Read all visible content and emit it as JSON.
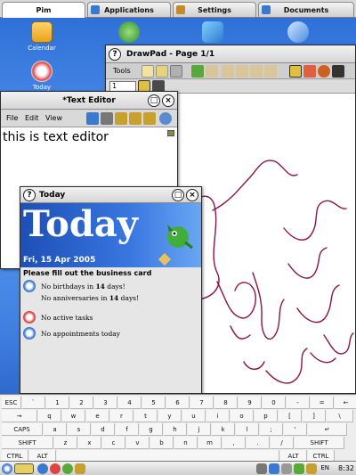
{
  "tabs": [
    {
      "label": "Pim",
      "active": true
    },
    {
      "label": "Applications",
      "active": false
    },
    {
      "label": "Settings",
      "active": false
    },
    {
      "label": "Documents",
      "active": false
    }
  ],
  "desktop_icons": [
    {
      "label": "Calendar",
      "icon": "calendar-icon"
    },
    {
      "label": "Today",
      "icon": "today-icon"
    }
  ],
  "drawpad": {
    "title": "DrawPad - Page 1/1",
    "tools_label": "Tools",
    "page_value": "1"
  },
  "text_editor": {
    "title": "*Text Editor",
    "menu": [
      "File",
      "Edit",
      "View"
    ],
    "content": "this is text editor"
  },
  "today": {
    "title": "Today",
    "banner": "Today",
    "date": "Fri, 15 Apr 2005",
    "message": "Please fill out the business card",
    "birthdays_pre": "No birthdays in ",
    "birthdays_n": "14",
    "birthdays_post": " days!",
    "anniv_pre": "No anniversaries in ",
    "anniv_n": "14",
    "anniv_post": " days!",
    "tasks": "No active tasks",
    "appointments": "No appointments today"
  },
  "keyboard": {
    "row1": [
      "ESC",
      "`",
      "1",
      "2",
      "3",
      "4",
      "5",
      "6",
      "7",
      "8",
      "9",
      "0",
      "-",
      "=",
      "←"
    ],
    "row2": [
      "→",
      "q",
      "w",
      "e",
      "r",
      "t",
      "y",
      "u",
      "i",
      "o",
      "p",
      "[",
      "]",
      "\\"
    ],
    "row3": [
      "CAPS",
      "a",
      "s",
      "d",
      "f",
      "g",
      "h",
      "j",
      "k",
      "l",
      ";",
      "'",
      "↵"
    ],
    "row4": [
      "SHIFT",
      "z",
      "x",
      "c",
      "v",
      "b",
      "n",
      "m",
      ",",
      ".",
      "/",
      "SHIFT"
    ],
    "row5": [
      "CTRL",
      "ALT",
      "ALT",
      "CTRL"
    ]
  },
  "taskbar": {
    "lang": "EN",
    "clock": "8:32"
  },
  "colors": {
    "desktop": "#3f7fe0",
    "ink": "#8a1446",
    "today_banner": "#2a63cc"
  }
}
